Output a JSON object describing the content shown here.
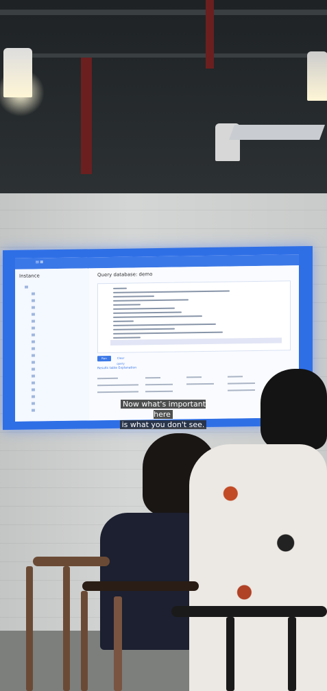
{
  "scene": {
    "description_free": true
  },
  "projection": {
    "app_title": "Instance",
    "panel_title": "Query database: demo",
    "caption_line1": "Now what's important here",
    "caption_line2": "is what you don't see.",
    "run_label": "Run query",
    "clear_label": "Clear query",
    "tabs_label": "Results table      Explanation"
  },
  "colors": {
    "screen": "#2f6fe6",
    "caption_bg": "#282828"
  }
}
